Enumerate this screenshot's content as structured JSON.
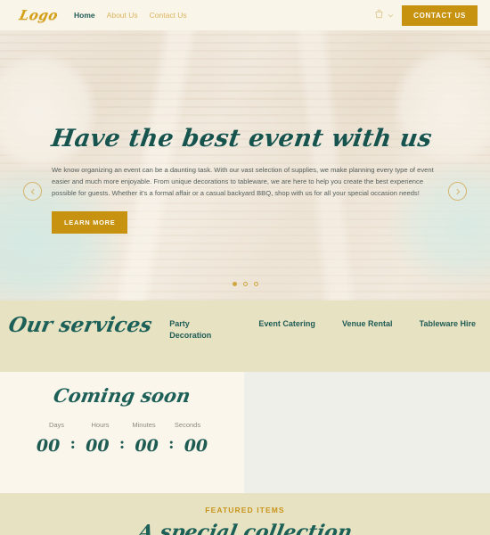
{
  "header": {
    "logo": "Logo",
    "nav": [
      {
        "label": "Home",
        "active": true
      },
      {
        "label": "About Us",
        "active": false
      },
      {
        "label": "Contact Us",
        "active": false
      }
    ],
    "cart_icon": "shopping-bag-icon",
    "chevron_icon": "chevron-down-icon",
    "contact_button": "CONTACT US"
  },
  "hero": {
    "title": "Have the best event with us",
    "paragraph": "We know organizing an event can be a daunting task. With our vast selection of supplies, we make planning every type of event easier and much more enjoyable. From unique decorations to tableware, we are here to help you create the best experience possible for guests. Whether it's a formal affair or a casual backyard BBQ, shop with us for all your special occasion needs!",
    "cta": "LEARN MORE",
    "prev_icon": "chevron-left-icon",
    "next_icon": "chevron-right-icon",
    "slides": 3,
    "active_slide": 1
  },
  "services": {
    "title": "Our services",
    "items": [
      {
        "label": "Party Decoration"
      },
      {
        "label": "Event Catering"
      },
      {
        "label": "Venue Rental"
      },
      {
        "label": "Tableware Hire"
      }
    ]
  },
  "coming_soon": {
    "title": "Coming soon",
    "separator": ":",
    "units": [
      {
        "label": "Days",
        "value": "00"
      },
      {
        "label": "Hours",
        "value": "00"
      },
      {
        "label": "Minutes",
        "value": "00"
      },
      {
        "label": "Seconds",
        "value": "00"
      }
    ]
  },
  "featured": {
    "eyebrow": "FEATURED ITEMS",
    "title": "A special collection"
  },
  "colors": {
    "gold": "#c89211",
    "gold_light": "#d9b45e",
    "teal": "#1f5b55",
    "cream": "#fbf6ec",
    "khaki": "#e7e2c2"
  }
}
